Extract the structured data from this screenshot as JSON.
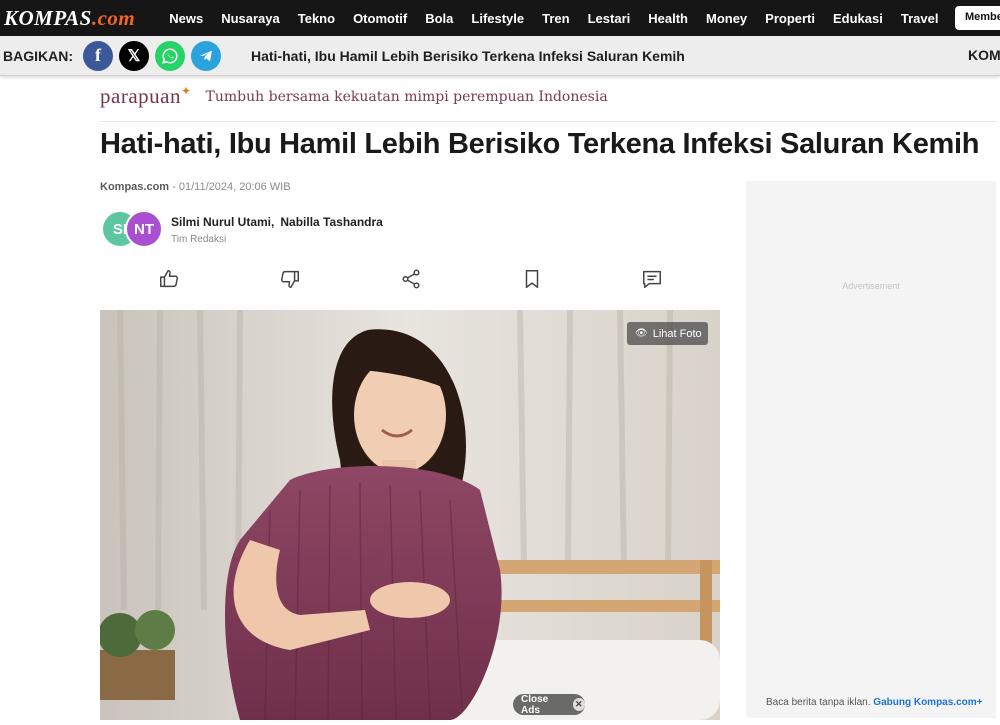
{
  "header": {
    "logo_text": "KOMPAS",
    "logo_suffix": ".com",
    "nav": [
      "News",
      "Nusaraya",
      "Tekno",
      "Otomotif",
      "Bola",
      "Lifestyle",
      "Tren",
      "Lestari",
      "Health",
      "Money",
      "Properti",
      "Edukasi",
      "Travel"
    ],
    "menu_icon": "≡",
    "member_label": "Member"
  },
  "sharebar": {
    "label": "BAGIKAN:",
    "icons": [
      "facebook-icon",
      "x-icon",
      "whatsapp-icon",
      "telegram-icon"
    ],
    "title": "Hati-hati, Ibu Hamil Lebih Berisiko Terkena Infeksi Saluran Kemih",
    "right_text": "KOM"
  },
  "parapuan": {
    "logo": "parapuan",
    "tagline": "Tumbuh bersama kekuatan mimpi perempuan Indonesia"
  },
  "article": {
    "headline": "Hati-hati, Ibu Hamil Lebih Berisiko Terkena Infeksi Saluran Kemih",
    "source": "Kompas.com",
    "date": " - 01/11/2024, 20:06 WIB",
    "avatars": [
      "SI",
      "NT"
    ],
    "author1": "Silmi Nurul Utami,",
    "author2": "Nabilla Tashandra",
    "team": "Tim Redaksi"
  },
  "actions": [
    "like-icon",
    "dislike-icon",
    "share-icon",
    "bookmark-icon",
    "comment-icon"
  ],
  "photo": {
    "view_label": "Lihat Foto",
    "close_ads_label": "Close Ads"
  },
  "ad": {
    "label": "Advertisement",
    "footer_text": "Baca berita tanpa iklan.",
    "footer_link": "Gabung Kompas.com+"
  },
  "colors": {
    "nav_bg": "#161616",
    "accent": "#f26522",
    "facebook": "#3b5998",
    "whatsapp": "#25d366",
    "telegram": "#2aa2dd",
    "parapuan": "#7a3648",
    "link": "#1e73d8"
  }
}
